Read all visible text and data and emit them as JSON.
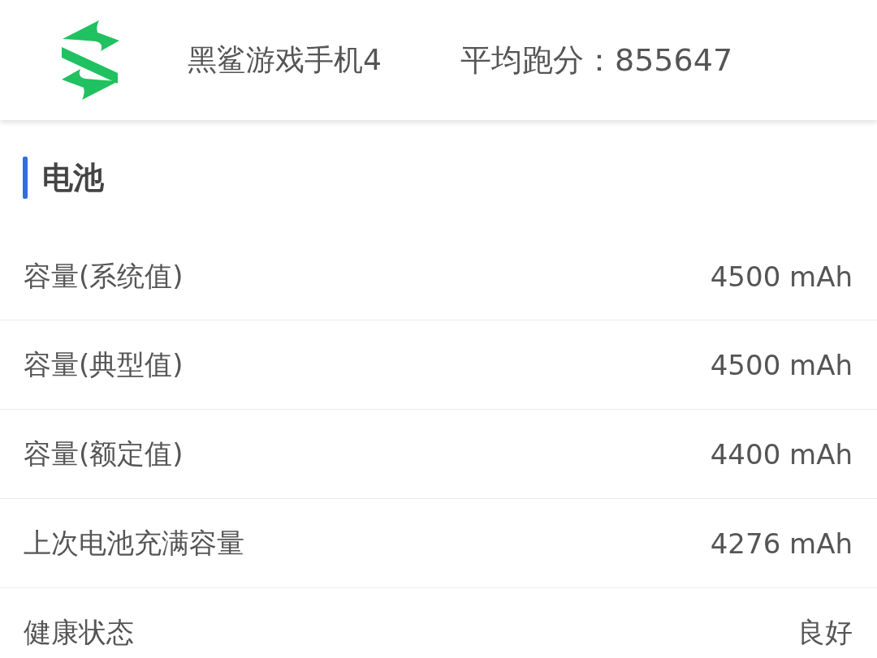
{
  "header": {
    "device_name": "黑鲨游戏手机4",
    "score": "平均跑分：855647"
  },
  "section": {
    "title": "电池",
    "rows": [
      {
        "label": "容量(系统值)",
        "value": "4500 mAh"
      },
      {
        "label": "容量(典型值)",
        "value": "4500 mAh"
      },
      {
        "label": "容量(额定值)",
        "value": "4400 mAh"
      },
      {
        "label": "上次电池充满容量",
        "value": "4276 mAh"
      },
      {
        "label": "健康状态",
        "value": "良好"
      }
    ]
  }
}
